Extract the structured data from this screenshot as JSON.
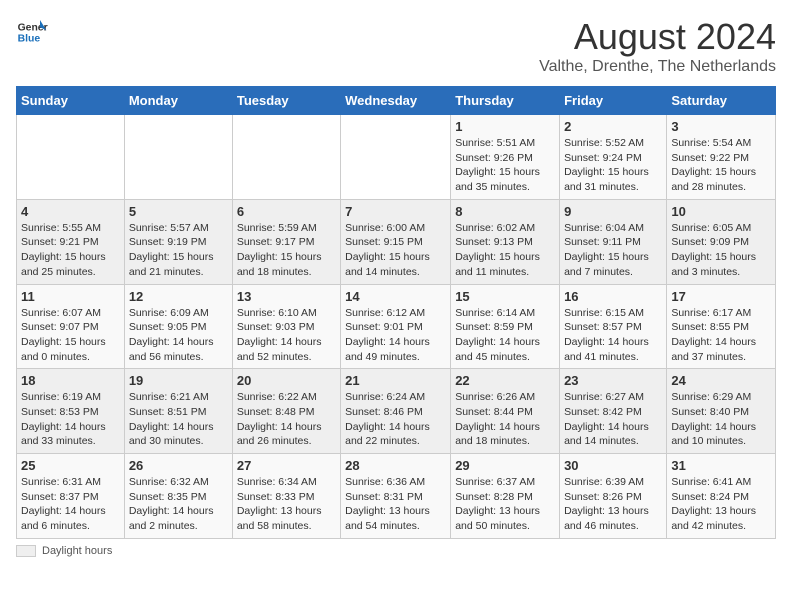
{
  "header": {
    "logo_general": "General",
    "logo_blue": "Blue",
    "month_year": "August 2024",
    "location": "Valthe, Drenthe, The Netherlands"
  },
  "days_of_week": [
    "Sunday",
    "Monday",
    "Tuesday",
    "Wednesday",
    "Thursday",
    "Friday",
    "Saturday"
  ],
  "weeks": [
    [
      {
        "day": "",
        "info": ""
      },
      {
        "day": "",
        "info": ""
      },
      {
        "day": "",
        "info": ""
      },
      {
        "day": "",
        "info": ""
      },
      {
        "day": "1",
        "info": "Sunrise: 5:51 AM\nSunset: 9:26 PM\nDaylight: 15 hours\nand 35 minutes."
      },
      {
        "day": "2",
        "info": "Sunrise: 5:52 AM\nSunset: 9:24 PM\nDaylight: 15 hours\nand 31 minutes."
      },
      {
        "day": "3",
        "info": "Sunrise: 5:54 AM\nSunset: 9:22 PM\nDaylight: 15 hours\nand 28 minutes."
      }
    ],
    [
      {
        "day": "4",
        "info": "Sunrise: 5:55 AM\nSunset: 9:21 PM\nDaylight: 15 hours\nand 25 minutes."
      },
      {
        "day": "5",
        "info": "Sunrise: 5:57 AM\nSunset: 9:19 PM\nDaylight: 15 hours\nand 21 minutes."
      },
      {
        "day": "6",
        "info": "Sunrise: 5:59 AM\nSunset: 9:17 PM\nDaylight: 15 hours\nand 18 minutes."
      },
      {
        "day": "7",
        "info": "Sunrise: 6:00 AM\nSunset: 9:15 PM\nDaylight: 15 hours\nand 14 minutes."
      },
      {
        "day": "8",
        "info": "Sunrise: 6:02 AM\nSunset: 9:13 PM\nDaylight: 15 hours\nand 11 minutes."
      },
      {
        "day": "9",
        "info": "Sunrise: 6:04 AM\nSunset: 9:11 PM\nDaylight: 15 hours\nand 7 minutes."
      },
      {
        "day": "10",
        "info": "Sunrise: 6:05 AM\nSunset: 9:09 PM\nDaylight: 15 hours\nand 3 minutes."
      }
    ],
    [
      {
        "day": "11",
        "info": "Sunrise: 6:07 AM\nSunset: 9:07 PM\nDaylight: 15 hours\nand 0 minutes."
      },
      {
        "day": "12",
        "info": "Sunrise: 6:09 AM\nSunset: 9:05 PM\nDaylight: 14 hours\nand 56 minutes."
      },
      {
        "day": "13",
        "info": "Sunrise: 6:10 AM\nSunset: 9:03 PM\nDaylight: 14 hours\nand 52 minutes."
      },
      {
        "day": "14",
        "info": "Sunrise: 6:12 AM\nSunset: 9:01 PM\nDaylight: 14 hours\nand 49 minutes."
      },
      {
        "day": "15",
        "info": "Sunrise: 6:14 AM\nSunset: 8:59 PM\nDaylight: 14 hours\nand 45 minutes."
      },
      {
        "day": "16",
        "info": "Sunrise: 6:15 AM\nSunset: 8:57 PM\nDaylight: 14 hours\nand 41 minutes."
      },
      {
        "day": "17",
        "info": "Sunrise: 6:17 AM\nSunset: 8:55 PM\nDaylight: 14 hours\nand 37 minutes."
      }
    ],
    [
      {
        "day": "18",
        "info": "Sunrise: 6:19 AM\nSunset: 8:53 PM\nDaylight: 14 hours\nand 33 minutes."
      },
      {
        "day": "19",
        "info": "Sunrise: 6:21 AM\nSunset: 8:51 PM\nDaylight: 14 hours\nand 30 minutes."
      },
      {
        "day": "20",
        "info": "Sunrise: 6:22 AM\nSunset: 8:48 PM\nDaylight: 14 hours\nand 26 minutes."
      },
      {
        "day": "21",
        "info": "Sunrise: 6:24 AM\nSunset: 8:46 PM\nDaylight: 14 hours\nand 22 minutes."
      },
      {
        "day": "22",
        "info": "Sunrise: 6:26 AM\nSunset: 8:44 PM\nDaylight: 14 hours\nand 18 minutes."
      },
      {
        "day": "23",
        "info": "Sunrise: 6:27 AM\nSunset: 8:42 PM\nDaylight: 14 hours\nand 14 minutes."
      },
      {
        "day": "24",
        "info": "Sunrise: 6:29 AM\nSunset: 8:40 PM\nDaylight: 14 hours\nand 10 minutes."
      }
    ],
    [
      {
        "day": "25",
        "info": "Sunrise: 6:31 AM\nSunset: 8:37 PM\nDaylight: 14 hours\nand 6 minutes."
      },
      {
        "day": "26",
        "info": "Sunrise: 6:32 AM\nSunset: 8:35 PM\nDaylight: 14 hours\nand 2 minutes."
      },
      {
        "day": "27",
        "info": "Sunrise: 6:34 AM\nSunset: 8:33 PM\nDaylight: 13 hours\nand 58 minutes."
      },
      {
        "day": "28",
        "info": "Sunrise: 6:36 AM\nSunset: 8:31 PM\nDaylight: 13 hours\nand 54 minutes."
      },
      {
        "day": "29",
        "info": "Sunrise: 6:37 AM\nSunset: 8:28 PM\nDaylight: 13 hours\nand 50 minutes."
      },
      {
        "day": "30",
        "info": "Sunrise: 6:39 AM\nSunset: 8:26 PM\nDaylight: 13 hours\nand 46 minutes."
      },
      {
        "day": "31",
        "info": "Sunrise: 6:41 AM\nSunset: 8:24 PM\nDaylight: 13 hours\nand 42 minutes."
      }
    ]
  ],
  "footer": {
    "daylight_label": "Daylight hours"
  }
}
